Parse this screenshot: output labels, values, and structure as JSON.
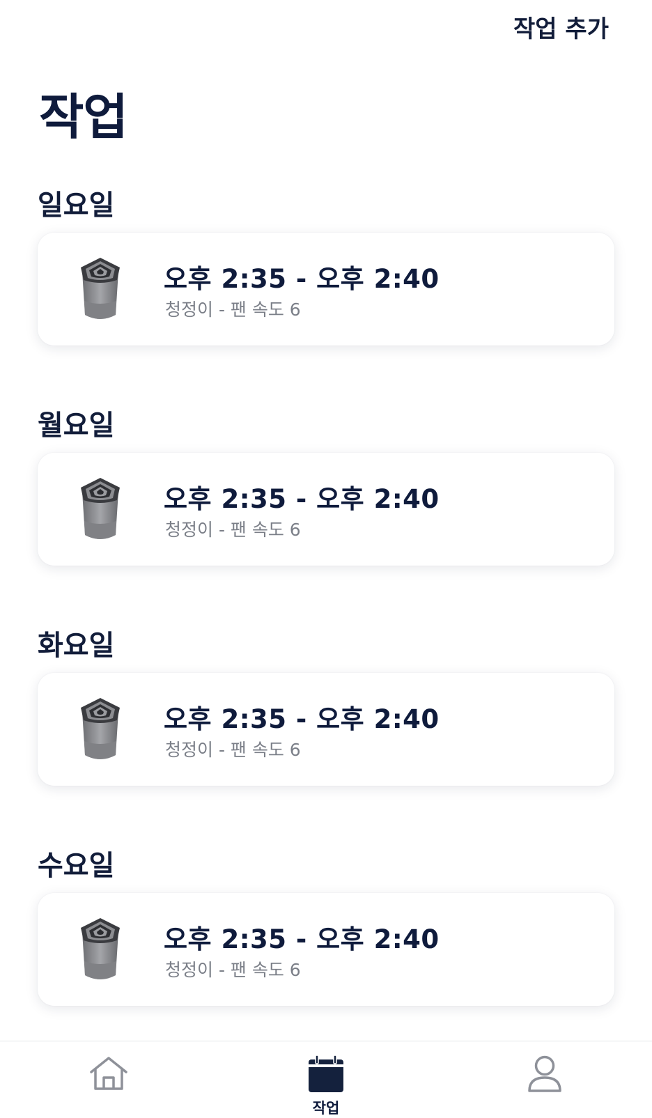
{
  "header": {
    "add_task_label": "작업 추가",
    "title": "작업"
  },
  "days": [
    {
      "label": "일요일",
      "task": {
        "time": "오후 2:35 - 오후 2:40",
        "detail": "청정이 - 팬 속도 6",
        "icon": "air-purifier-icon"
      }
    },
    {
      "label": "월요일",
      "task": {
        "time": "오후 2:35 - 오후 2:40",
        "detail": "청정이 - 팬 속도 6",
        "icon": "air-purifier-icon"
      }
    },
    {
      "label": "화요일",
      "task": {
        "time": "오후 2:35 - 오후 2:40",
        "detail": "청정이 - 팬 속도 6",
        "icon": "air-purifier-icon"
      }
    },
    {
      "label": "수요일",
      "task": {
        "time": "오후 2:35 - 오후 2:40",
        "detail": "청정이 - 팬 속도 6",
        "icon": "air-purifier-icon"
      }
    }
  ],
  "bottom_nav": {
    "items": [
      {
        "icon": "home-icon",
        "label": "",
        "active": false
      },
      {
        "icon": "calendar-icon",
        "label": "작업",
        "active": true
      },
      {
        "icon": "profile-icon",
        "label": "",
        "active": false
      }
    ]
  },
  "colors": {
    "primary_text": "#0f1b3c",
    "secondary_text": "#7b7f88",
    "inactive_icon": "#8e9199",
    "background": "#ffffff"
  }
}
